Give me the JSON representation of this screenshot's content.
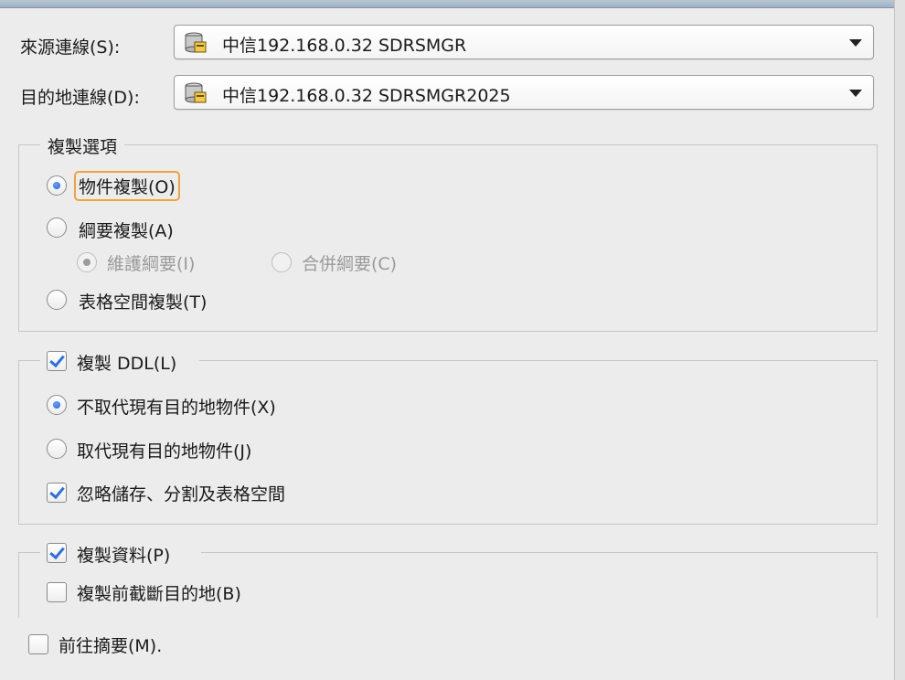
{
  "source": {
    "label": "來源連線(S):",
    "value": "中信192.168.0.32 SDRSMGR"
  },
  "target": {
    "label": "目的地連線(D):",
    "value": "中信192.168.0.32 SDRSMGR2025"
  },
  "copy_options": {
    "title": "複製選項",
    "object_copy": "物件複製(O)",
    "schema_copy": "綱要複製(A)",
    "maintain_schema": "維護綱要(I)",
    "merge_schema": "合併綱要(C)",
    "tablespace_copy": "表格空間複製(T)"
  },
  "ddl": {
    "title": "複製 DDL(L)",
    "no_replace": "不取代現有目的地物件(X)",
    "replace": "取代現有目的地物件(J)",
    "ignore_storage": "忽略儲存、分割及表格空間"
  },
  "data": {
    "title": "複製資料(P)",
    "truncate": "複製前截斷目的地(B)"
  },
  "summary": "前往摘要(M)."
}
